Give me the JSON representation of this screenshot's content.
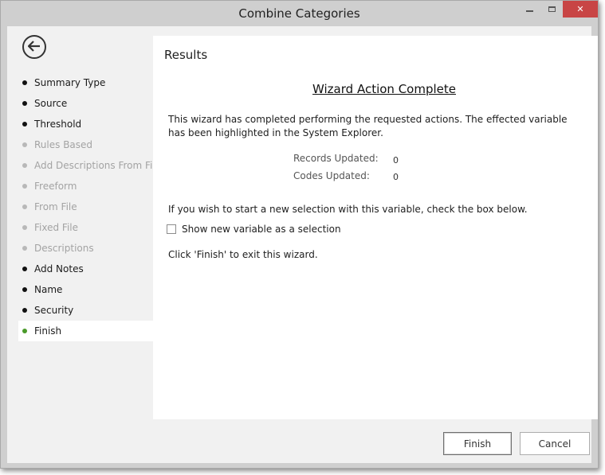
{
  "window": {
    "title": "Combine Categories",
    "controls": {
      "minimize": "minimize-icon",
      "maximize": "maximize-icon",
      "close": "close-icon",
      "close_glyph": "✕"
    },
    "close_color": "#c84545"
  },
  "sidebar": {
    "back_icon": "back-arrow-icon",
    "steps": [
      {
        "label": "Summary Type",
        "state": "done"
      },
      {
        "label": "Source",
        "state": "done"
      },
      {
        "label": "Threshold",
        "state": "done"
      },
      {
        "label": "Rules Based",
        "state": "disabled"
      },
      {
        "label": "Add Descriptions From File",
        "state": "disabled"
      },
      {
        "label": "Freeform",
        "state": "disabled"
      },
      {
        "label": "From File",
        "state": "disabled"
      },
      {
        "label": "Fixed File",
        "state": "disabled"
      },
      {
        "label": "Descriptions",
        "state": "disabled"
      },
      {
        "label": "Add Notes",
        "state": "done"
      },
      {
        "label": "Name",
        "state": "done"
      },
      {
        "label": "Security",
        "state": "done"
      },
      {
        "label": "Finish",
        "state": "active"
      }
    ],
    "active_color": "#4a9a2a"
  },
  "main": {
    "section_title": "Results",
    "heading": "Wizard Action Complete",
    "description": "This wizard has completed performing the requested actions. The effected variable has been highlighted in the System Explorer.",
    "stats": [
      {
        "label": "Records Updated:",
        "value": "0"
      },
      {
        "label": "Codes Updated:",
        "value": "0"
      }
    ],
    "new_selection_text": "If you wish to start a new selection with this variable, check the box below.",
    "checkbox_label": "Show new variable as a selection",
    "checkbox_checked": false,
    "exit_text": "Click 'Finish' to exit this wizard."
  },
  "footer": {
    "finish_label": "Finish",
    "cancel_label": "Cancel"
  }
}
